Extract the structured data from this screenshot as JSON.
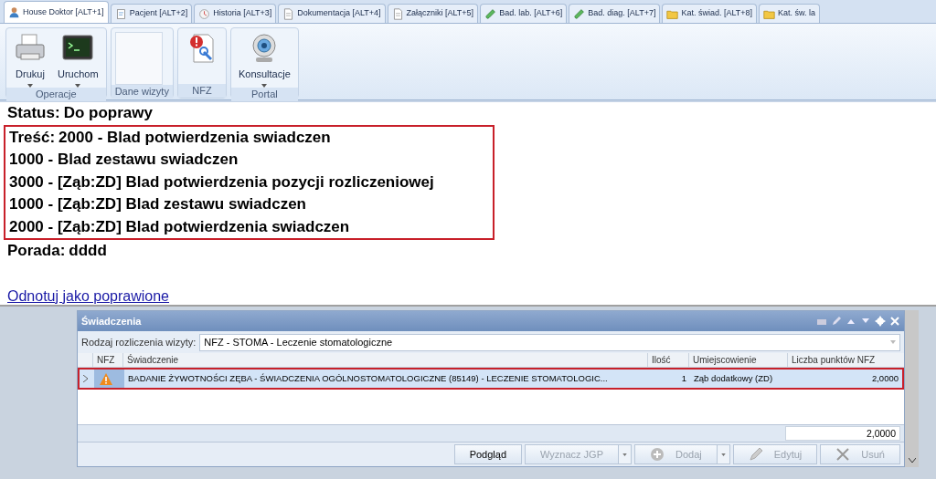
{
  "tabs": [
    {
      "label": "House Doktor [ALT+1]",
      "kind": "person",
      "selected": true
    },
    {
      "label": "Pacjent [ALT+2]",
      "kind": "note",
      "selected": false
    },
    {
      "label": "Historia [ALT+3]",
      "kind": "clock",
      "selected": false
    },
    {
      "label": "Dokumentacja [ALT+4]",
      "kind": "doc",
      "selected": false
    },
    {
      "label": "Załączniki [ALT+5]",
      "kind": "doc",
      "selected": false
    },
    {
      "label": "Bad. lab. [ALT+6]",
      "kind": "tube",
      "selected": false
    },
    {
      "label": "Bad. diag. [ALT+7]",
      "kind": "tube",
      "selected": false
    },
    {
      "label": "Kat. świad. [ALT+8]",
      "kind": "folder",
      "selected": false
    },
    {
      "label": "Kat. św. la",
      "kind": "folder",
      "selected": false
    }
  ],
  "ribbon": [
    {
      "label": "Operacje",
      "buttons": [
        {
          "label": "Drukuj",
          "kind": "printer",
          "dropdown": true
        },
        {
          "label": "Uruchom",
          "kind": "terminal",
          "dropdown": true
        }
      ]
    },
    {
      "label": "Dane wizyty"
    },
    {
      "label": "NFZ",
      "buttons": [
        {
          "kind": "report",
          "dropdown": false
        }
      ]
    },
    {
      "label": "Portal",
      "buttons": [
        {
          "label": "Konsultacje",
          "kind": "webcam",
          "dropdown": true
        }
      ]
    }
  ],
  "message": {
    "status_label": "Status:",
    "status": "Do poprawy",
    "content_label": "Treść:",
    "annotated": true,
    "lines": [
      "2000 - Blad potwierdzenia swiadczen",
      "1000 - Blad zestawu swiadczen",
      "3000 - [Ząb:ZD] Blad potwierdzenia pozycji rozliczeniowej",
      "1000 - [Ząb:ZD] Blad zestawu swiadczen",
      "2000 - [Ząb:ZD] Blad potwierdzenia swiadczen"
    ],
    "advice_label": "Porada:",
    "advice": "dddd",
    "link": "Odnotuj jako poprawione"
  },
  "panel": {
    "title": "Świadczenia",
    "settlement_label": "Rodzaj rozliczenia wizyty:",
    "settlement": "NFZ - STOMA - Leczenie stomatologiczne",
    "columns": [
      "NFZ",
      "Świadczenie",
      "Ilość",
      "Umiejscowienie",
      "Liczba punktów NFZ"
    ],
    "rows": [
      {
        "warning": true,
        "selected": true,
        "annotated": true,
        "service": "BADANIE ŻYWOTNOŚCI ZĘBA - ŚWIADCZENIA OGÓLNOSTOMATOLOGICZNE (85149) - LECZENIE STOMATOLOGIC...",
        "quantity": "1",
        "location": "Ząb dodatkowy (ZD)",
        "points": "2,0000"
      }
    ],
    "total": "2,0000",
    "buttons": [
      {
        "label": "Podgląd",
        "kind": "plain",
        "disabled": false,
        "menu": false
      },
      {
        "label": "Wyznacz JGP",
        "kind": "plain",
        "disabled": true,
        "menu": true
      },
      {
        "label": "Dodaj",
        "kind": "plus",
        "disabled": true,
        "menu": true
      },
      {
        "label": "Edytuj",
        "kind": "pencil",
        "disabled": true,
        "menu": false
      },
      {
        "label": "Usuń",
        "kind": "x",
        "disabled": true,
        "menu": false
      }
    ]
  }
}
